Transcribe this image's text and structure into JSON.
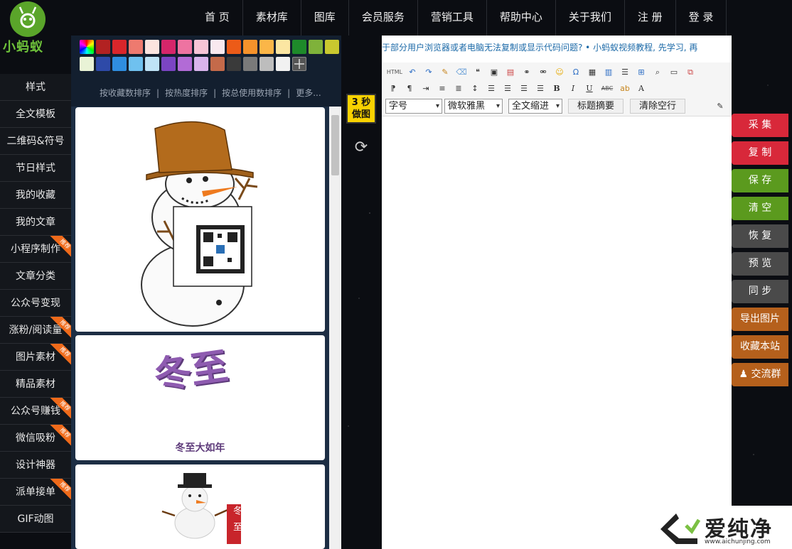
{
  "logo": {
    "text": "小蚂蚁"
  },
  "top_nav": [
    "首 页",
    "素材库",
    "图库",
    "会员服务",
    "营销工具",
    "帮助中心",
    "关于我们",
    "注 册",
    "登 录"
  ],
  "left_nav": [
    {
      "label": "样式",
      "hot": false
    },
    {
      "label": "全文模板",
      "hot": false
    },
    {
      "label": "二维码&符号",
      "hot": false
    },
    {
      "label": "节日样式",
      "hot": false
    },
    {
      "label": "我的收藏",
      "hot": false
    },
    {
      "label": "我的文章",
      "hot": false
    },
    {
      "label": "小程序制作",
      "hot": true
    },
    {
      "label": "文章分类",
      "hot": false
    },
    {
      "label": "公众号变现",
      "hot": false
    },
    {
      "label": "涨粉/阅读量",
      "hot": true
    },
    {
      "label": "图片素材",
      "hot": true
    },
    {
      "label": "精品素材",
      "hot": false
    },
    {
      "label": "公众号赚钱",
      "hot": true
    },
    {
      "label": "微信吸粉",
      "hot": true
    },
    {
      "label": "设计神器",
      "hot": false
    },
    {
      "label": "派单接单",
      "hot": true
    },
    {
      "label": "GIF动图",
      "hot": false
    }
  ],
  "hot_badge": "推荐",
  "palette": {
    "colors": [
      "#rainbow",
      "#b22222",
      "#d9262b",
      "#ee7a6f",
      "#fbe4df",
      "#d5266a",
      "#ee73a1",
      "#f7c4d6",
      "#f9e9ef",
      "#ec5b18",
      "#f6922b",
      "#fbb648",
      "#fbe6a2",
      "#1e8a2a",
      "#7fb23a",
      "#c9c82f",
      "#e9f3d6",
      "#2e4aa8",
      "#2f8ee0",
      "#6fc1ef",
      "#bfe3f6",
      "#7b45c3",
      "#b26bd6",
      "#d9b4ec",
      "#c46a4a",
      "#3a3a3a",
      "#7a7a7a",
      "#bdbdbd",
      "#f1f1f1",
      "#grid"
    ]
  },
  "sort_bar": [
    "按收藏数排序",
    "按热度排序",
    "按总使用数排序",
    "更多..."
  ],
  "cards": [
    {
      "caption": ""
    },
    {
      "title_art": "冬至",
      "caption": "冬至大如年"
    },
    {
      "tag": "冬至"
    }
  ],
  "badge_3s": {
    "line1": "3 秒",
    "line2": "做图"
  },
  "marquee": "于部分用户浏览器或者电脑无法复制或显示代码问题?   •   小蚂蚁视频教程, 先学习, 再",
  "toolbar": {
    "font_size": "字号",
    "font_family": "微软雅黑",
    "indent": "全文缩进",
    "summary_btn": "标题摘要",
    "clear_btn": "清除空行",
    "html_label": "HTML"
  },
  "actions": [
    {
      "label": "采 集",
      "color": "#d8283a"
    },
    {
      "label": "复 制",
      "color": "#d8283a"
    },
    {
      "label": "保 存",
      "color": "#5b9a1e"
    },
    {
      "label": "清 空",
      "color": "#5b9a1e"
    },
    {
      "label": "恢 复",
      "color": "#4a4a4a"
    },
    {
      "label": "预 览",
      "color": "#4a4a4a"
    },
    {
      "label": "同 步",
      "color": "#4a4a4a"
    },
    {
      "label": "导出图片",
      "color": "#b5601c"
    },
    {
      "label": "收藏本站",
      "color": "#b5601c"
    },
    {
      "label": "交流群",
      "color": "#b5601c"
    }
  ],
  "watermark": {
    "text": "爱纯净",
    "url": "www.aichunjing.com"
  }
}
